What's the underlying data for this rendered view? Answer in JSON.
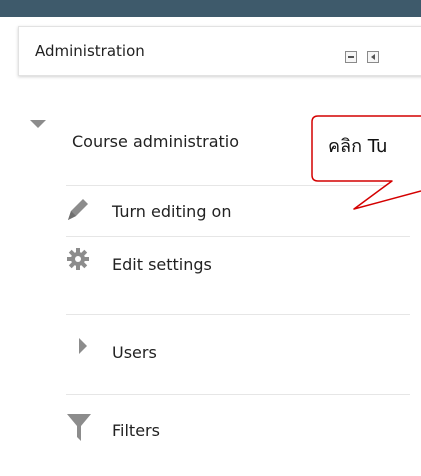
{
  "block": {
    "title": "Administration"
  },
  "tree": {
    "root_label": "Course administratio",
    "items": [
      {
        "label": "Turn editing on",
        "icon": "pencil-icon"
      },
      {
        "label": "Edit settings",
        "icon": "gear-icon"
      },
      {
        "label": "Users",
        "icon": "caret-right-icon"
      },
      {
        "label": "Filters",
        "icon": "filter-icon"
      }
    ]
  },
  "callout": {
    "text": "คลิก Tu"
  },
  "colors": {
    "topbar": "#3e5a6b",
    "callout_border": "#d40000",
    "icon_gray": "#8c8c8c"
  }
}
